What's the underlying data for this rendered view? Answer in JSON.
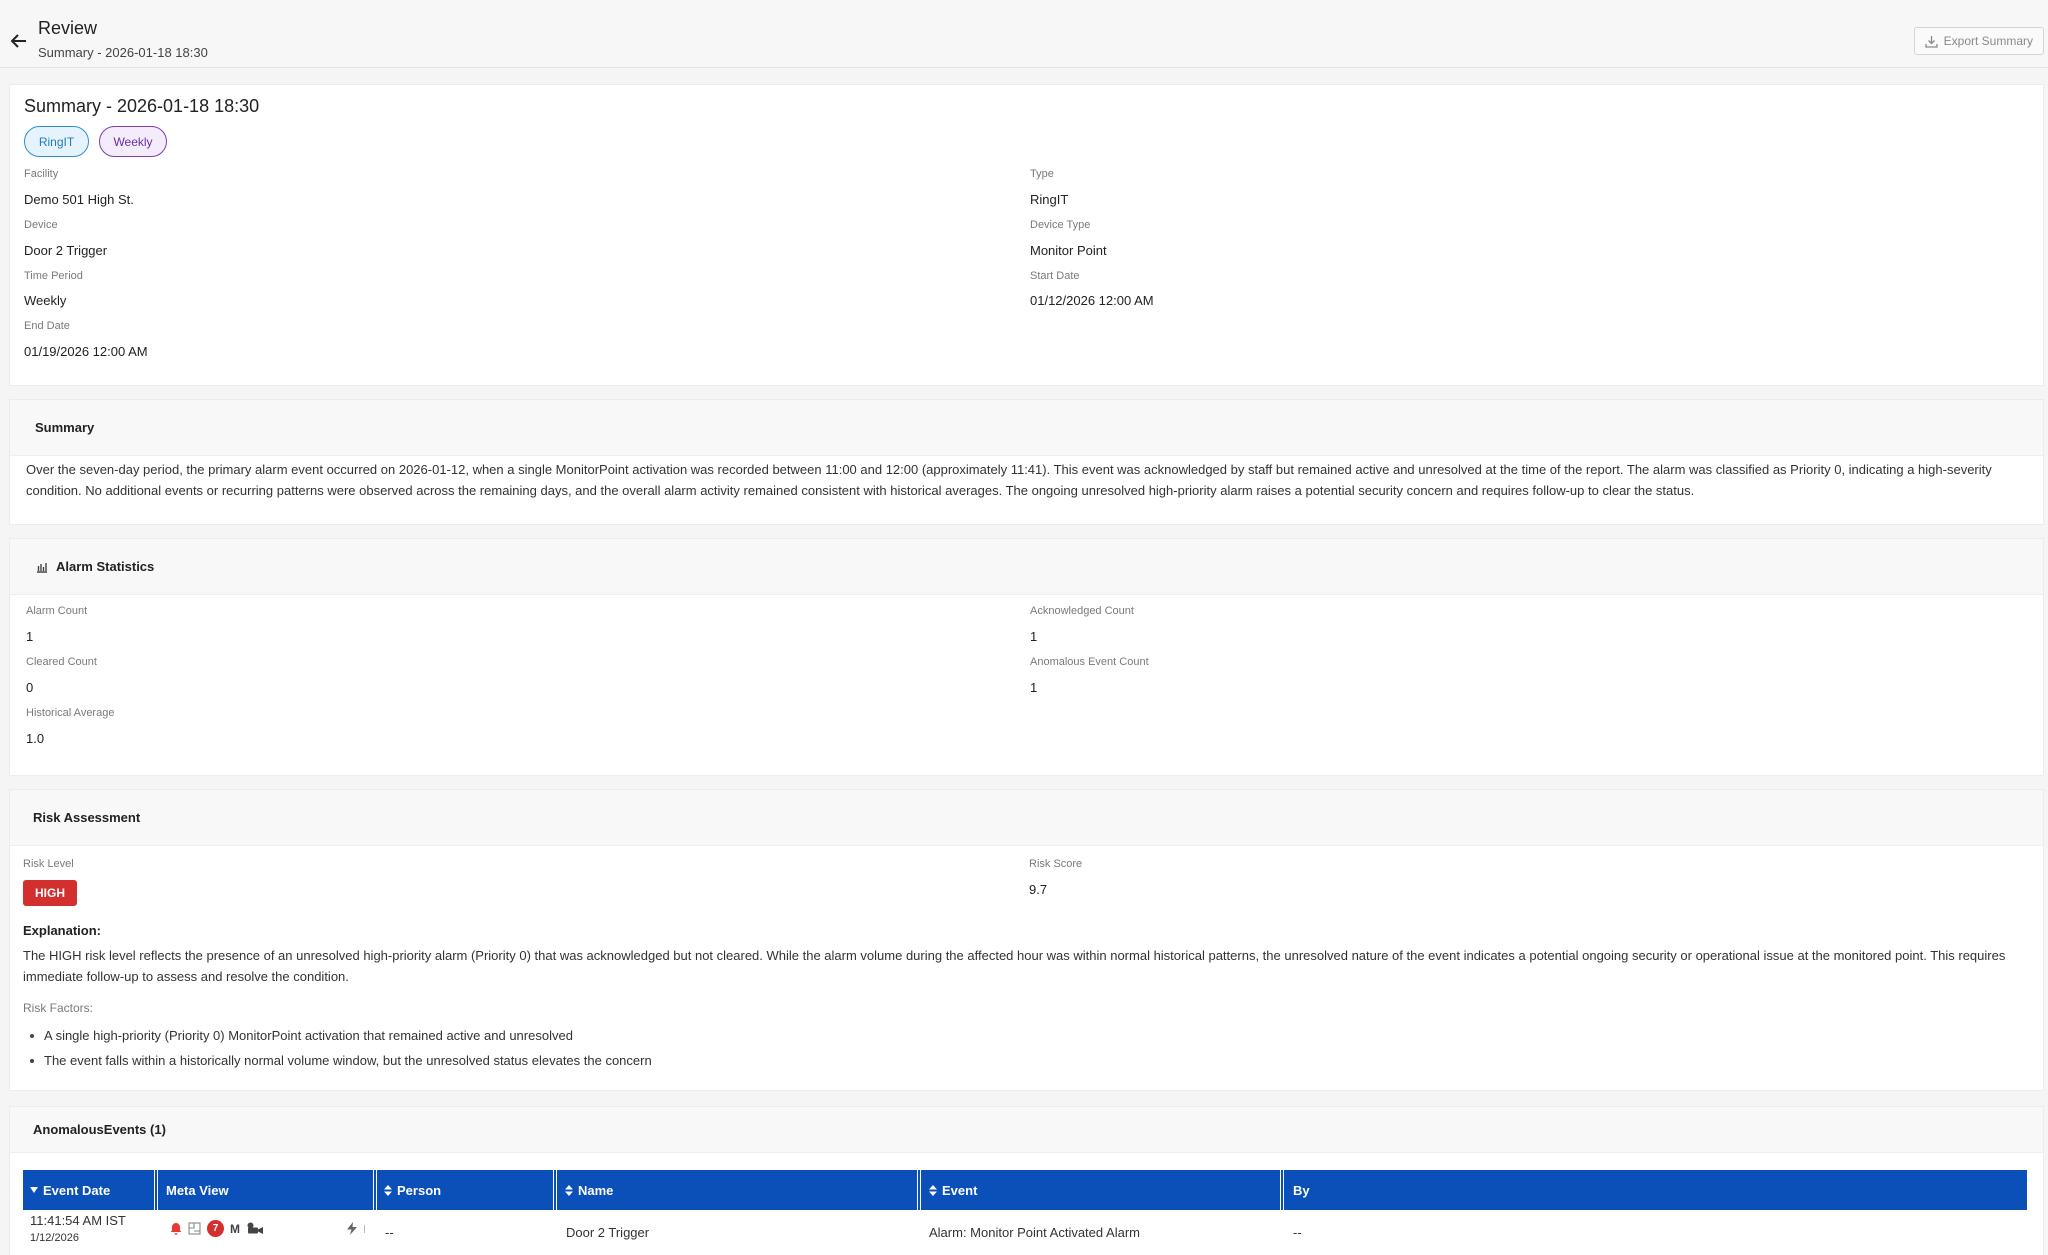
{
  "header": {
    "title": "Review",
    "subtitle": "Summary - 2026-01-18 18:30",
    "export_label": "Export Summary"
  },
  "details": {
    "title": "Summary - 2026-01-18 18:30",
    "chips": [
      "RingIT",
      "Weekly"
    ],
    "facility_label": "Facility",
    "facility": "Demo 501 High St.",
    "type_label": "Type",
    "type": "RingIT",
    "device_label": "Device",
    "device": "Door 2 Trigger",
    "device_type_label": "Device Type",
    "device_type": "Monitor Point",
    "time_period_label": "Time Period",
    "time_period": "Weekly",
    "start_date_label": "Start Date",
    "start_date": "01/12/2026 12:00 AM",
    "end_date_label": "End Date",
    "end_date": "01/19/2026 12:00 AM"
  },
  "summary": {
    "heading": "Summary",
    "text": "Over the seven-day period, the primary alarm event occurred on 2026-01-12, when a single MonitorPoint activation was recorded between 11:00 and 12:00 (approximately 11:41). This event was acknowledged by staff but remained active and unresolved at the time of the report. The alarm was classified as Priority 0, indicating a high-severity condition. No additional events or recurring patterns were observed across the remaining days, and the overall alarm activity remained consistent with historical averages. The ongoing unresolved high-priority alarm raises a potential security concern and requires follow-up to clear the status."
  },
  "alarm_stats": {
    "heading": "Alarm Statistics",
    "alarm_count_label": "Alarm Count",
    "alarm_count": "1",
    "acknowledged_count_label": "Acknowledged Count",
    "acknowledged_count": "1",
    "cleared_count_label": "Cleared Count",
    "cleared_count": "0",
    "anomalous_event_count_label": "Anomalous Event Count",
    "anomalous_event_count": "1",
    "historical_average_label": "Historical Average",
    "historical_average": "1.0"
  },
  "risk": {
    "heading": "Risk Assessment",
    "level_label": "Risk Level",
    "level": "HIGH",
    "level_color": "#d32f2f",
    "score_label": "Risk Score",
    "score": "9.7",
    "explanation_label": "Explanation:",
    "explanation": "The HIGH risk level reflects the presence of an unresolved high-priority alarm (Priority 0) that was acknowledged but not cleared. While the alarm volume during the affected hour was within normal historical patterns, the unresolved nature of the event indicates a potential ongoing security or operational issue at the monitored point. This requires immediate follow-up to assess and resolve the condition.",
    "factors_label": "Risk Factors:",
    "factors": [
      "A single high-priority (Priority 0) MonitorPoint activation that remained active and unresolved",
      "The event falls within a historically normal volume window, but the unresolved status elevates the concern"
    ]
  },
  "anomalous": {
    "heading": "AnomalousEvents (1)",
    "header_color": "#0b4fb8",
    "columns": [
      "Event Date",
      "Meta View",
      "Person",
      "Name",
      "Event",
      "By"
    ],
    "rows": [
      {
        "time": "11:41:54 AM IST",
        "date": "1/12/2026",
        "meta_badge": "7",
        "meta_letter": "M",
        "person": "--",
        "name": "Door 2 Trigger",
        "event": "Alarm: Monitor Point Activated Alarm",
        "by": "--"
      }
    ]
  }
}
